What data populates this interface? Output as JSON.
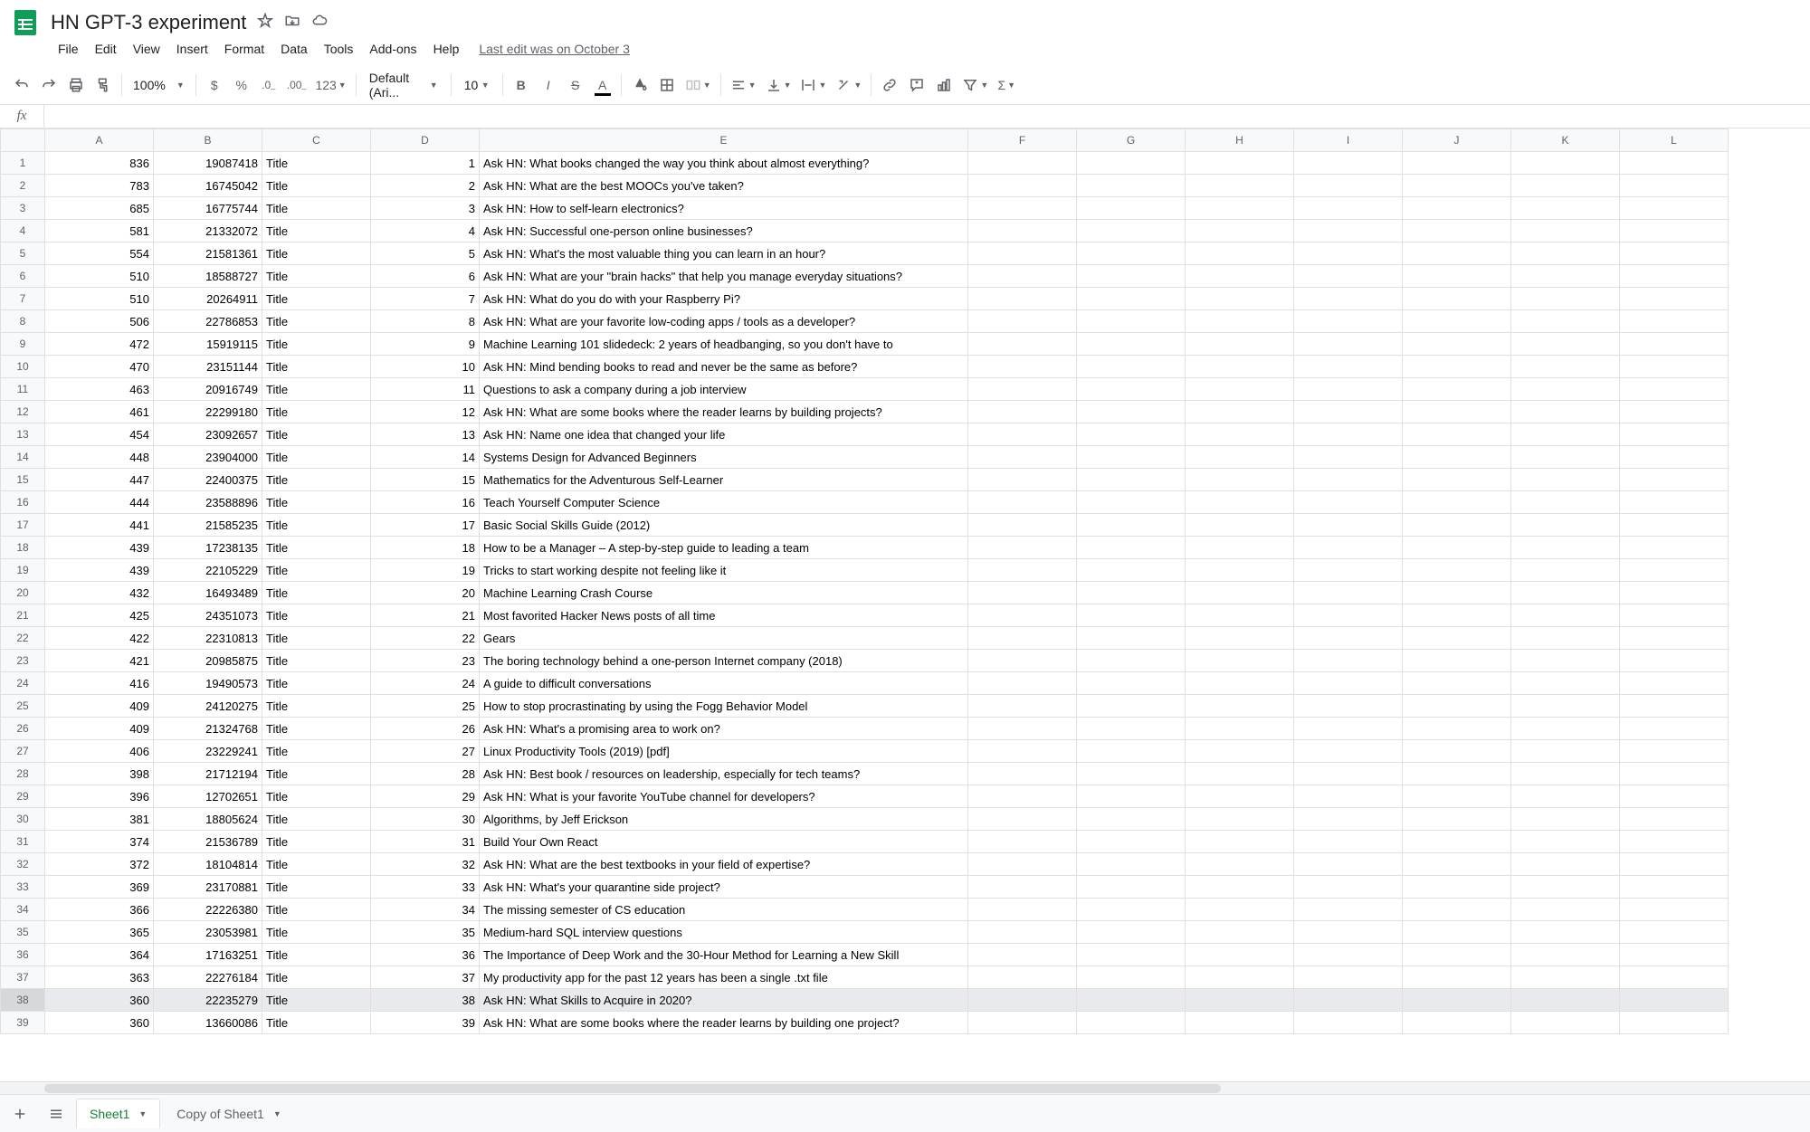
{
  "doc": {
    "title": "HN GPT-3 experiment"
  },
  "menu": [
    "File",
    "Edit",
    "View",
    "Insert",
    "Format",
    "Data",
    "Tools",
    "Add-ons",
    "Help"
  ],
  "last_edit": "Last edit was on October 3",
  "toolbar": {
    "zoom": "100%",
    "font": "Default (Ari...",
    "size": "10"
  },
  "columns": [
    "A",
    "B",
    "C",
    "D",
    "E",
    "F",
    "G",
    "H",
    "I",
    "J",
    "K",
    "L"
  ],
  "rows": [
    {
      "n": 1,
      "a": 836,
      "b": 19087418,
      "c": "Title",
      "d": 1,
      "e": "Ask HN: What books changed the way you think about almost everything?"
    },
    {
      "n": 2,
      "a": 783,
      "b": 16745042,
      "c": "Title",
      "d": 2,
      "e": "Ask HN: What are the best MOOCs you've taken?"
    },
    {
      "n": 3,
      "a": 685,
      "b": 16775744,
      "c": "Title",
      "d": 3,
      "e": "Ask HN: How to self-learn electronics?"
    },
    {
      "n": 4,
      "a": 581,
      "b": 21332072,
      "c": "Title",
      "d": 4,
      "e": "Ask HN: Successful one-person online businesses?"
    },
    {
      "n": 5,
      "a": 554,
      "b": 21581361,
      "c": "Title",
      "d": 5,
      "e": "Ask HN: What's the most valuable thing you can learn in an hour?"
    },
    {
      "n": 6,
      "a": 510,
      "b": 18588727,
      "c": "Title",
      "d": 6,
      "e": "Ask HN: What are your \"brain hacks\" that help you manage everyday situations?"
    },
    {
      "n": 7,
      "a": 510,
      "b": 20264911,
      "c": "Title",
      "d": 7,
      "e": "Ask HN: What do you do with your Raspberry Pi?"
    },
    {
      "n": 8,
      "a": 506,
      "b": 22786853,
      "c": "Title",
      "d": 8,
      "e": "Ask HN: What are your favorite low-coding apps / tools as a developer?"
    },
    {
      "n": 9,
      "a": 472,
      "b": 15919115,
      "c": "Title",
      "d": 9,
      "e": "Machine Learning 101 slidedeck: 2 years of headbanging, so you don't have to"
    },
    {
      "n": 10,
      "a": 470,
      "b": 23151144,
      "c": "Title",
      "d": 10,
      "e": "Ask HN: Mind bending books to read and never be the same as before?"
    },
    {
      "n": 11,
      "a": 463,
      "b": 20916749,
      "c": "Title",
      "d": 11,
      "e": "Questions to ask a company during a job interview"
    },
    {
      "n": 12,
      "a": 461,
      "b": 22299180,
      "c": "Title",
      "d": 12,
      "e": "Ask HN: What are some books where the reader learns by building projects?"
    },
    {
      "n": 13,
      "a": 454,
      "b": 23092657,
      "c": "Title",
      "d": 13,
      "e": "Ask HN: Name one idea that changed your life"
    },
    {
      "n": 14,
      "a": 448,
      "b": 23904000,
      "c": "Title",
      "d": 14,
      "e": "Systems Design for Advanced Beginners"
    },
    {
      "n": 15,
      "a": 447,
      "b": 22400375,
      "c": "Title",
      "d": 15,
      "e": "Mathematics for the Adventurous Self-Learner"
    },
    {
      "n": 16,
      "a": 444,
      "b": 23588896,
      "c": "Title",
      "d": 16,
      "e": "Teach Yourself Computer Science"
    },
    {
      "n": 17,
      "a": 441,
      "b": 21585235,
      "c": "Title",
      "d": 17,
      "e": "Basic Social Skills Guide (2012)"
    },
    {
      "n": 18,
      "a": 439,
      "b": 17238135,
      "c": "Title",
      "d": 18,
      "e": "How to be a Manager – A step-by-step guide to leading a team"
    },
    {
      "n": 19,
      "a": 439,
      "b": 22105229,
      "c": "Title",
      "d": 19,
      "e": "Tricks to start working despite not feeling like it"
    },
    {
      "n": 20,
      "a": 432,
      "b": 16493489,
      "c": "Title",
      "d": 20,
      "e": "Machine Learning Crash Course"
    },
    {
      "n": 21,
      "a": 425,
      "b": 24351073,
      "c": "Title",
      "d": 21,
      "e": "Most favorited Hacker News posts of all time"
    },
    {
      "n": 22,
      "a": 422,
      "b": 22310813,
      "c": "Title",
      "d": 22,
      "e": "Gears"
    },
    {
      "n": 23,
      "a": 421,
      "b": 20985875,
      "c": "Title",
      "d": 23,
      "e": "The boring technology behind a one-person Internet company (2018)"
    },
    {
      "n": 24,
      "a": 416,
      "b": 19490573,
      "c": "Title",
      "d": 24,
      "e": "A guide to difficult conversations"
    },
    {
      "n": 25,
      "a": 409,
      "b": 24120275,
      "c": "Title",
      "d": 25,
      "e": "How to stop procrastinating by using the Fogg Behavior Model"
    },
    {
      "n": 26,
      "a": 409,
      "b": 21324768,
      "c": "Title",
      "d": 26,
      "e": "Ask HN: What's a promising area to work on?"
    },
    {
      "n": 27,
      "a": 406,
      "b": 23229241,
      "c": "Title",
      "d": 27,
      "e": "Linux Productivity Tools (2019) [pdf]"
    },
    {
      "n": 28,
      "a": 398,
      "b": 21712194,
      "c": "Title",
      "d": 28,
      "e": "Ask HN: Best book / resources on leadership, especially for tech teams?"
    },
    {
      "n": 29,
      "a": 396,
      "b": 12702651,
      "c": "Title",
      "d": 29,
      "e": "Ask HN: What is your favorite YouTube channel for developers?"
    },
    {
      "n": 30,
      "a": 381,
      "b": 18805624,
      "c": "Title",
      "d": 30,
      "e": "Algorithms, by Jeff Erickson"
    },
    {
      "n": 31,
      "a": 374,
      "b": 21536789,
      "c": "Title",
      "d": 31,
      "e": "Build Your Own React"
    },
    {
      "n": 32,
      "a": 372,
      "b": 18104814,
      "c": "Title",
      "d": 32,
      "e": "Ask HN: What are the best textbooks in your field of expertise?"
    },
    {
      "n": 33,
      "a": 369,
      "b": 23170881,
      "c": "Title",
      "d": 33,
      "e": "Ask HN: What's your quarantine side project?"
    },
    {
      "n": 34,
      "a": 366,
      "b": 22226380,
      "c": "Title",
      "d": 34,
      "e": "The missing semester of CS education"
    },
    {
      "n": 35,
      "a": 365,
      "b": 23053981,
      "c": "Title",
      "d": 35,
      "e": "Medium-hard SQL interview questions"
    },
    {
      "n": 36,
      "a": 364,
      "b": 17163251,
      "c": "Title",
      "d": 36,
      "e": "The Importance of Deep Work and the 30-Hour Method for Learning a New Skill"
    },
    {
      "n": 37,
      "a": 363,
      "b": 22276184,
      "c": "Title",
      "d": 37,
      "e": "My productivity app for the past 12 years has been a single .txt file"
    },
    {
      "n": 38,
      "a": 360,
      "b": 22235279,
      "c": "Title",
      "d": 38,
      "e": "Ask HN: What Skills to Acquire in 2020?"
    },
    {
      "n": 39,
      "a": 360,
      "b": 13660086,
      "c": "Title",
      "d": 39,
      "e": "Ask HN: What are some books where the reader learns by building one project?"
    }
  ],
  "selected_row": 38,
  "tabs": {
    "active": "Sheet1",
    "other": "Copy of Sheet1"
  }
}
